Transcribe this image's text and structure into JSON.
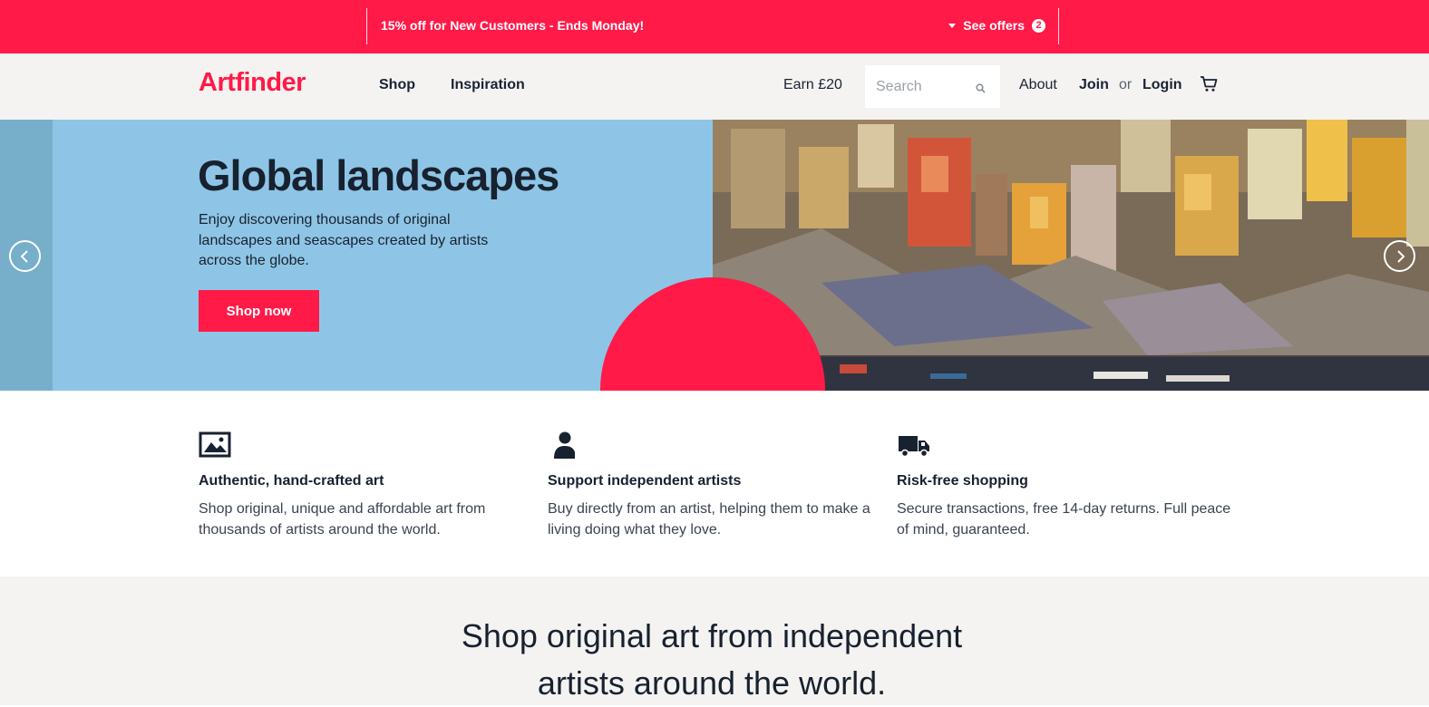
{
  "promo": {
    "text": "15% off for New Customers - Ends Monday!",
    "offers_label": "See offers",
    "offers_count": "2"
  },
  "header": {
    "logo": "Artfinder",
    "nav": [
      "Shop",
      "Inspiration"
    ],
    "earn": "Earn £20",
    "search_placeholder": "Search",
    "about": "About",
    "join": "Join",
    "or": "or",
    "login": "Login"
  },
  "hero": {
    "title": "Global landscapes",
    "description": "Enjoy discovering thousands of original landscapes and seascapes created by artists across the globe.",
    "cta": "Shop now",
    "colors": {
      "panel": "#8ec5e6",
      "accent": "#ff1a48"
    }
  },
  "features": [
    {
      "icon": "image-icon",
      "title": "Authentic, hand-crafted art",
      "text": "Shop original, unique and affordable art from thousands of artists around the world."
    },
    {
      "icon": "person-icon",
      "title": "Support independent artists",
      "text": "Buy directly from an artist, helping them to make a living doing what they love."
    },
    {
      "icon": "truck-icon",
      "title": "Risk-free shopping",
      "text": "Secure transactions, free 14-day returns. Full peace of mind, guaranteed."
    }
  ],
  "bottom": {
    "line1": "Shop original art from independent",
    "line2": "artists around the world."
  },
  "brand_color": "#ff1a48"
}
